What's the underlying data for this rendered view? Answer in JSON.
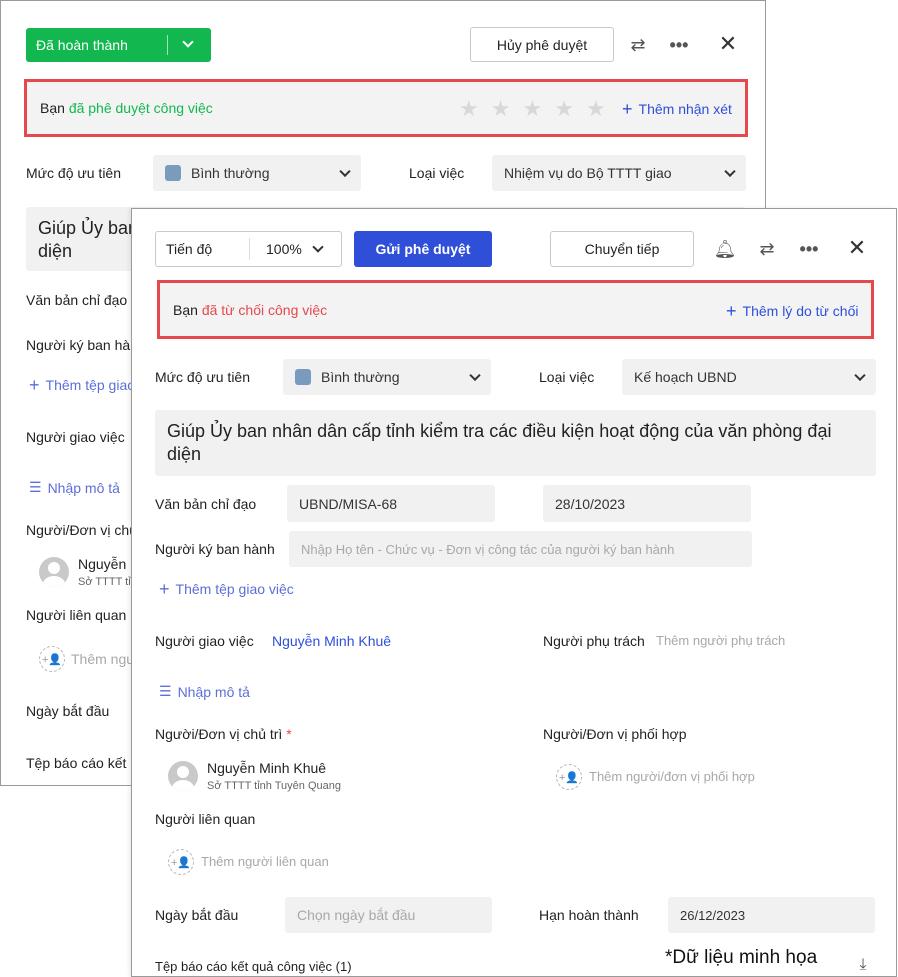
{
  "back": {
    "status_button": "Đã hoàn thành",
    "cancel_approve": "Hủy phê duyệt",
    "banner_prefix": "Bạn",
    "banner_status": "đã phê duyệt công việc",
    "banner_action": "Thêm nhận xét",
    "priority_label": "Mức độ ưu tiên",
    "priority_value": "Bình thường",
    "type_label": "Loại việc",
    "type_value": "Nhiệm vụ do Bộ TTTT giao",
    "title_line1": "Giúp Ủy ban",
    "title_line2": "diện",
    "directive_label": "Văn bản chỉ đạo",
    "signer_label": "Người ký ban hà",
    "attach_label": "Thêm tệp giao",
    "assigner_label": "Người giao việc",
    "desc_label": "Nhập mô tả",
    "owner_label": "Người/Đơn vị chủ",
    "owner_name": "Nguyễn",
    "owner_org": "Sở TTTT tỉn",
    "related_label": "Người liên quan",
    "related_add": "Thêm ngư",
    "start_label": "Ngày bắt đầu",
    "report_label": "Tệp báo cáo kết"
  },
  "front": {
    "progress_label": "Tiến độ",
    "progress_value": "100%",
    "send_approve": "Gửi phê duyệt",
    "forward": "Chuyển tiếp",
    "banner_prefix": "Bạn",
    "banner_status": "đã từ chối công việc",
    "banner_action": "Thêm lý do từ chối",
    "priority_label": "Mức độ ưu tiên",
    "priority_value": "Bình thường",
    "type_label": "Loại việc",
    "type_value": "Kế hoạch UBND",
    "title": "Giúp Ủy ban nhân dân cấp tỉnh kiểm tra các điều kiện hoạt động của văn phòng đại diện",
    "directive_label": "Văn bản chỉ đạo",
    "directive_value": "UBND/MISA-68",
    "directive_date": "28/10/2023",
    "signer_label": "Người ký ban hành",
    "signer_placeholder": "Nhập Họ tên - Chức vụ - Đơn vị công tác của người ký ban hành",
    "attach_label": "Thêm tệp giao việc",
    "assigner_label": "Người giao việc",
    "assigner_value": "Nguyễn Minh Khuê",
    "manager_label": "Người phụ trách",
    "manager_placeholder": "Thêm người phụ trách",
    "desc_label": "Nhập mô tả",
    "owner_label": "Người/Đơn vị chủ trì",
    "required_mark": "*",
    "owner_name": "Nguyễn Minh Khuê",
    "owner_org": "Sở TTTT tỉnh Tuyên Quang",
    "coop_label": "Người/Đơn vị phối hợp",
    "coop_placeholder": "Thêm người/đơn vị phối hợp",
    "related_label": "Người liên quan",
    "related_placeholder": "Thêm người liên quan",
    "start_label": "Ngày bắt đầu",
    "start_placeholder": "Chọn ngày bắt đầu",
    "deadline_label": "Hạn hoàn thành",
    "deadline_value": "26/12/2023",
    "report_label": "Tệp báo cáo kết quả công việc (1)"
  },
  "footnote": "*Dữ liệu minh họa",
  "colors": {
    "green": "#12b84f",
    "blue": "#2f4fd8",
    "red": "#e5484d",
    "link": "#5c6fd8"
  }
}
